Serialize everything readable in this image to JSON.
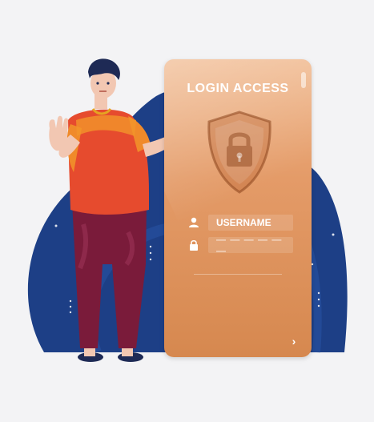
{
  "login_card": {
    "title": "LOGIN ACCESS",
    "username_label": "USERNAME",
    "password_placeholder": "— — — — — —"
  },
  "icons": {
    "shield": "shield-lock-icon",
    "user": "user-icon",
    "lock": "lock-icon",
    "next": "chevron-right-icon"
  },
  "colors": {
    "background": "#f3f3f5",
    "blob": "#1d3f86",
    "card": "#e49b68",
    "shirt": "#e64b2e",
    "pants": "#7a1b3a"
  }
}
